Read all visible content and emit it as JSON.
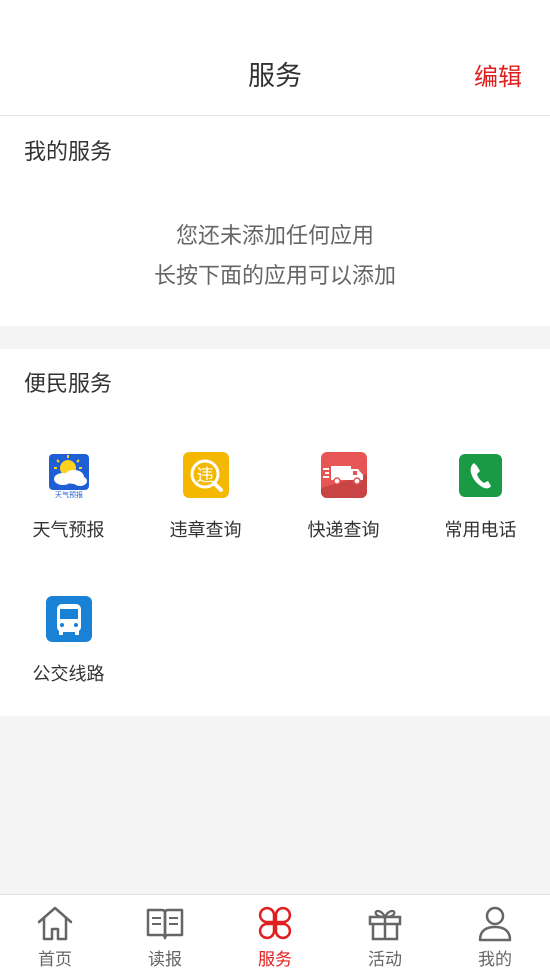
{
  "header": {
    "title": "服务",
    "edit_label": "编辑"
  },
  "my_services": {
    "title": "我的服务",
    "empty_line1": "您还未添加任何应用",
    "empty_line2": "长按下面的应用可以添加"
  },
  "convenience": {
    "title": "便民服务",
    "items": [
      {
        "label": "天气预报",
        "icon": "weather-icon",
        "color": "#1e5fd6"
      },
      {
        "label": "违章查询",
        "icon": "violation-icon",
        "color": "#f5b800"
      },
      {
        "label": "快递查询",
        "icon": "delivery-truck-icon",
        "color": "#e85555"
      },
      {
        "label": "常用电话",
        "icon": "phone-icon",
        "color": "#1a9a44"
      },
      {
        "label": "公交线路",
        "icon": "bus-icon",
        "color": "#1a82d6"
      }
    ],
    "weather_icon_text": "天气预报",
    "violation_icon_text": "违"
  },
  "tabbar": {
    "tabs": [
      {
        "label": "首页",
        "icon": "home-icon"
      },
      {
        "label": "读报",
        "icon": "newspaper-icon"
      },
      {
        "label": "服务",
        "icon": "services-icon"
      },
      {
        "label": "活动",
        "icon": "gift-icon"
      },
      {
        "label": "我的",
        "icon": "user-icon"
      }
    ],
    "active_index": 2
  },
  "colors": {
    "accent": "#e02020",
    "background": "#f4f4f4"
  }
}
